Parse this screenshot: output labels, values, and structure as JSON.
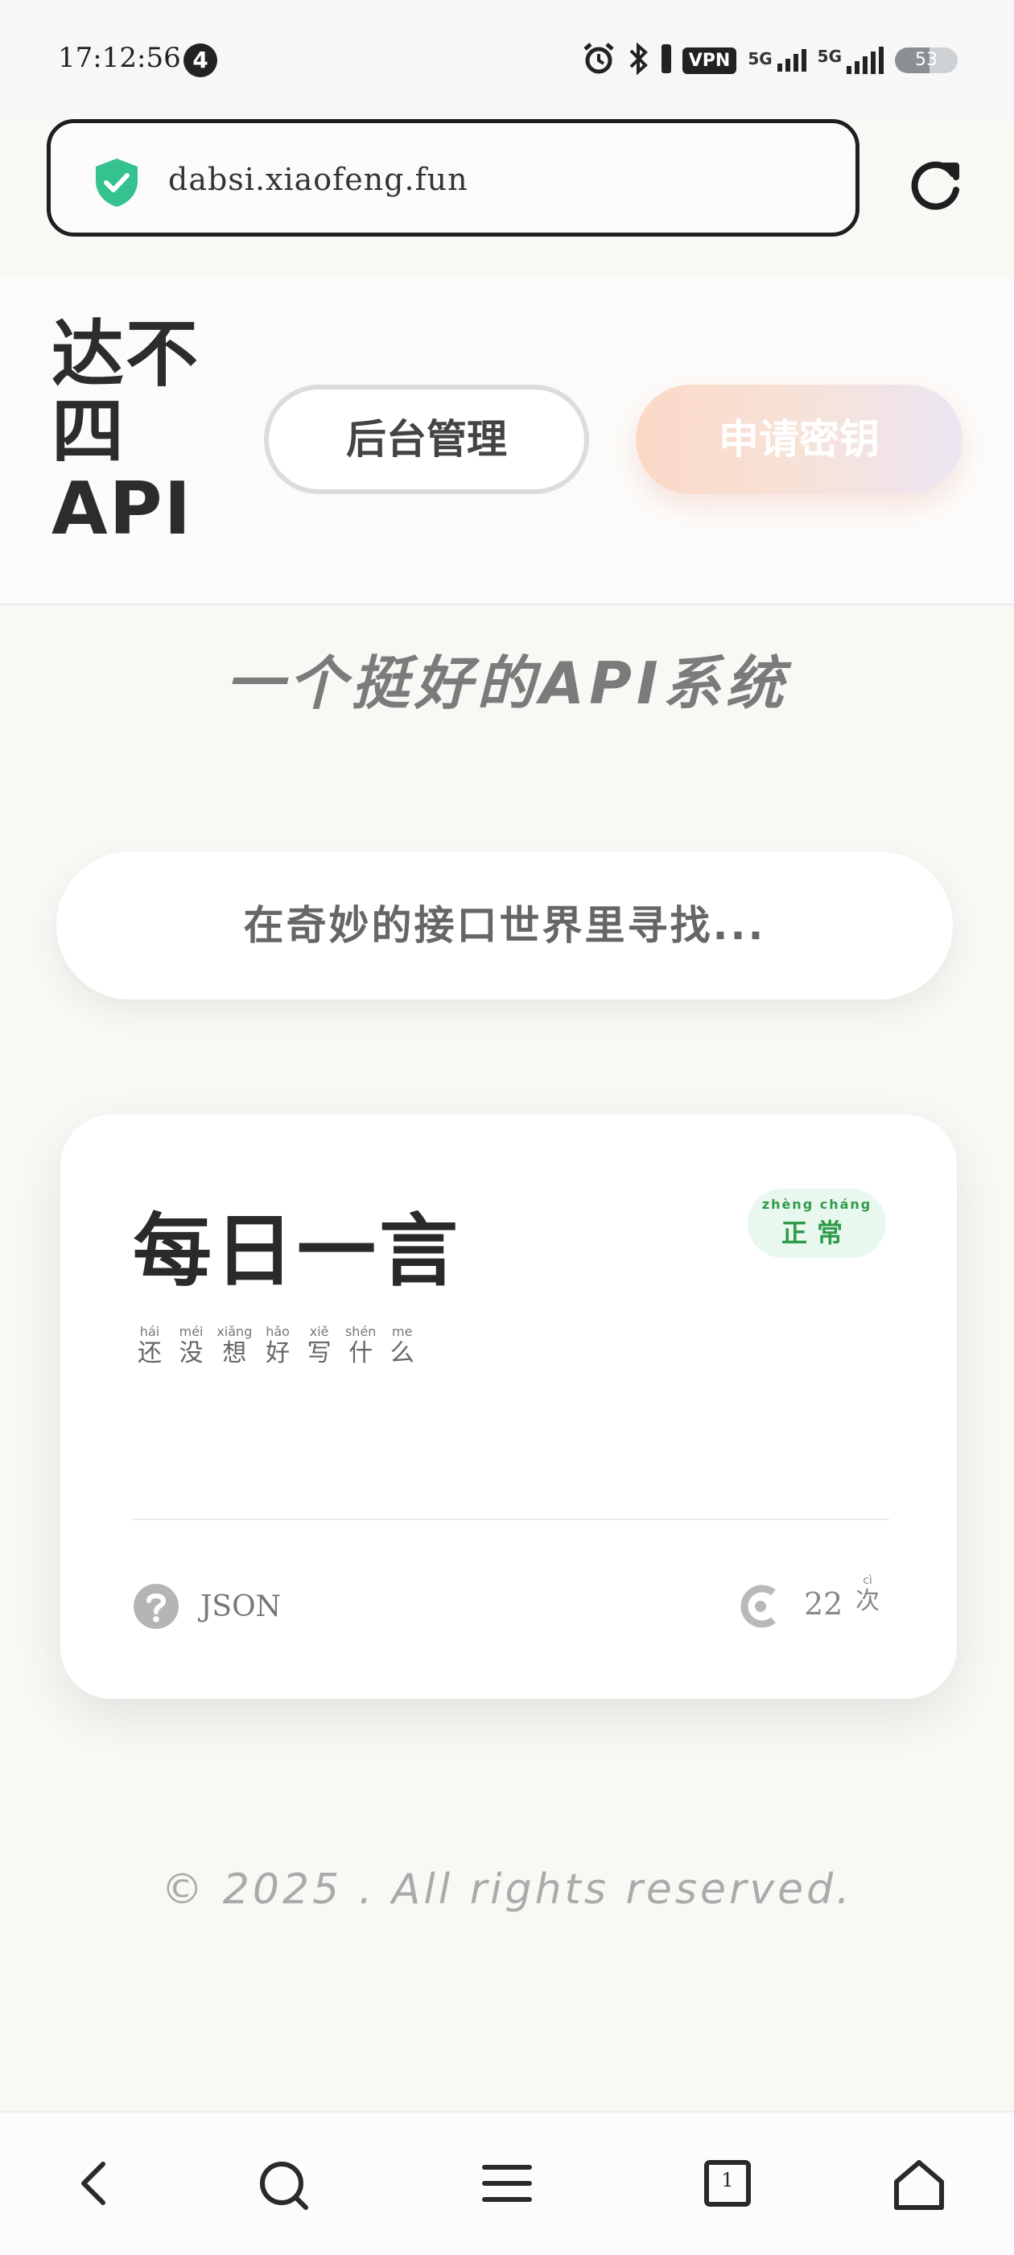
{
  "status_bar": {
    "time": "17:12:56",
    "notification_count": "4",
    "vpn": "VPN",
    "network_1": "5G",
    "network_2": "5G",
    "battery": "53"
  },
  "browser": {
    "url": "dabsi.xiaofeng.fun",
    "secure_color": "#34c38f"
  },
  "header": {
    "logo_line1": "达不",
    "logo_line2": "四",
    "logo_line3": "API",
    "admin_button": "后台管理",
    "apply_button": "申请密钥"
  },
  "hero": {
    "subtitle": "一个挺好的API系统"
  },
  "search": {
    "placeholder": "在奇妙的接口世界里寻找..."
  },
  "api_card": {
    "title": "每日一言",
    "status": {
      "text_1": "正",
      "text_2": "常",
      "pinyin_1": "zhèng",
      "pinyin_2": "cháng",
      "color": "#2e9a4a"
    },
    "description": [
      {
        "char": "还",
        "pinyin": "hái"
      },
      {
        "char": "没",
        "pinyin": "méi"
      },
      {
        "char": "想",
        "pinyin": "xiǎng"
      },
      {
        "char": "好",
        "pinyin": "hǎo"
      },
      {
        "char": "写",
        "pinyin": "xiě"
      },
      {
        "char": "什",
        "pinyin": "shén"
      },
      {
        "char": "么",
        "pinyin": "me"
      }
    ],
    "format": "JSON",
    "count": "22",
    "count_unit": "次",
    "count_unit_pinyin": "cì"
  },
  "footer": {
    "copyright": "© 2025 . All rights reserved."
  },
  "nav_bar": {
    "tab_count": "1"
  }
}
